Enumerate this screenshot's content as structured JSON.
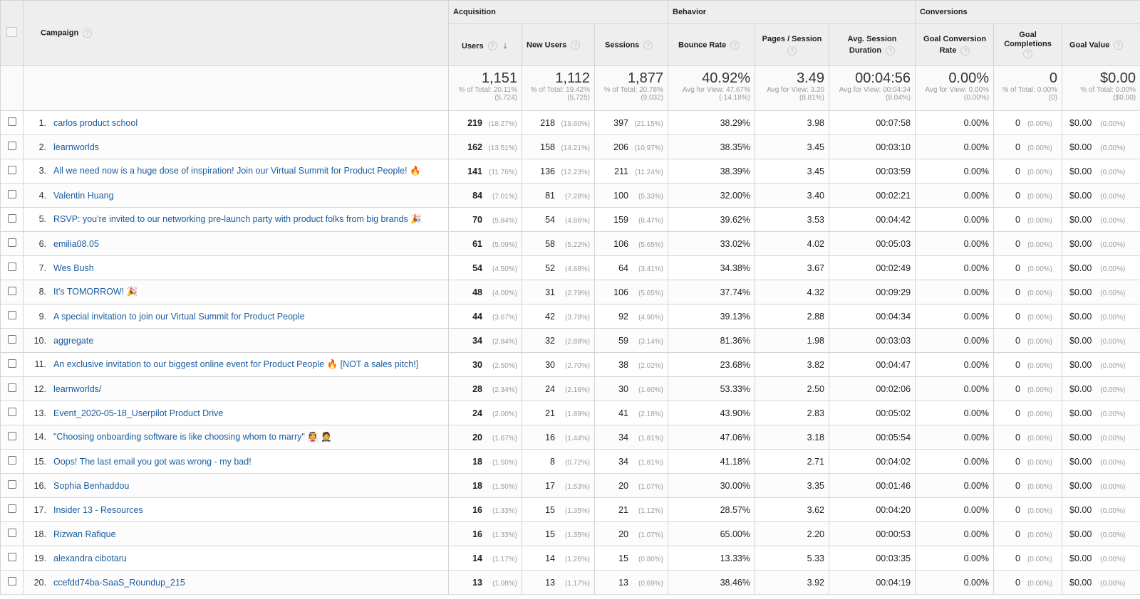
{
  "groups": {
    "acquisition": "Acquisition",
    "behavior": "Behavior",
    "conversions": "Conversions"
  },
  "columns": {
    "campaign": "Campaign",
    "users": "Users",
    "new_users": "New Users",
    "sessions": "Sessions",
    "bounce_rate": "Bounce Rate",
    "pages_session": "Pages / Session",
    "avg_duration": "Avg. Session Duration",
    "goal_conv_rate": "Goal Conversion Rate",
    "goal_completions": "Goal Completions",
    "goal_value": "Goal Value"
  },
  "help_icon": "?",
  "totals": {
    "users": {
      "value": "1,151",
      "sub": "% of Total: 20.11% (5,724)"
    },
    "new_users": {
      "value": "1,112",
      "sub": "% of Total: 19.42% (5,725)"
    },
    "sessions": {
      "value": "1,877",
      "sub": "% of Total: 20.78% (9,032)"
    },
    "bounce_rate": {
      "value": "40.92%",
      "sub": "Avg for View: 47.67% (-14.18%)"
    },
    "pages_session": {
      "value": "3.49",
      "sub": "Avg for View: 3.20 (8.81%)"
    },
    "avg_duration": {
      "value": "00:04:56",
      "sub": "Avg for View: 00:04:34 (8.04%)"
    },
    "goal_conv_rate": {
      "value": "0.00%",
      "sub": "Avg for View: 0.00% (0.00%)"
    },
    "goal_completions": {
      "value": "0",
      "sub": "% of Total: 0.00% (0)"
    },
    "goal_value": {
      "value": "$0.00",
      "sub": "% of Total: 0.00% ($0.00)"
    }
  },
  "rows": [
    {
      "n": "1.",
      "campaign": "carlos product school",
      "users": "219",
      "users_p": "(18.27%)",
      "new": "218",
      "new_p": "(19.60%)",
      "sessions": "397",
      "sessions_p": "(21.15%)",
      "bounce": "38.29%",
      "pages": "3.98",
      "dur": "00:07:58",
      "gcr": "0.00%",
      "gc": "0",
      "gc_p": "(0.00%)",
      "gv": "$0.00",
      "gv_p": "(0.00%)"
    },
    {
      "n": "2.",
      "campaign": "learnworlds",
      "users": "162",
      "users_p": "(13.51%)",
      "new": "158",
      "new_p": "(14.21%)",
      "sessions": "206",
      "sessions_p": "(10.97%)",
      "bounce": "38.35%",
      "pages": "3.45",
      "dur": "00:03:10",
      "gcr": "0.00%",
      "gc": "0",
      "gc_p": "(0.00%)",
      "gv": "$0.00",
      "gv_p": "(0.00%)"
    },
    {
      "n": "3.",
      "campaign": "All we need now is a huge dose of inspiration! Join our Virtual Summit for Product People! 🔥",
      "users": "141",
      "users_p": "(11.76%)",
      "new": "136",
      "new_p": "(12.23%)",
      "sessions": "211",
      "sessions_p": "(11.24%)",
      "bounce": "38.39%",
      "pages": "3.45",
      "dur": "00:03:59",
      "gcr": "0.00%",
      "gc": "0",
      "gc_p": "(0.00%)",
      "gv": "$0.00",
      "gv_p": "(0.00%)"
    },
    {
      "n": "4.",
      "campaign": "Valentin Huang",
      "users": "84",
      "users_p": "(7.01%)",
      "new": "81",
      "new_p": "(7.28%)",
      "sessions": "100",
      "sessions_p": "(5.33%)",
      "bounce": "32.00%",
      "pages": "3.40",
      "dur": "00:02:21",
      "gcr": "0.00%",
      "gc": "0",
      "gc_p": "(0.00%)",
      "gv": "$0.00",
      "gv_p": "(0.00%)"
    },
    {
      "n": "5.",
      "campaign": "RSVP: you're invited to our networking pre-launch party with product folks from big brands 🎉",
      "users": "70",
      "users_p": "(5.84%)",
      "new": "54",
      "new_p": "(4.86%)",
      "sessions": "159",
      "sessions_p": "(8.47%)",
      "bounce": "39.62%",
      "pages": "3.53",
      "dur": "00:04:42",
      "gcr": "0.00%",
      "gc": "0",
      "gc_p": "(0.00%)",
      "gv": "$0.00",
      "gv_p": "(0.00%)"
    },
    {
      "n": "6.",
      "campaign": "emilia08.05",
      "users": "61",
      "users_p": "(5.09%)",
      "new": "58",
      "new_p": "(5.22%)",
      "sessions": "106",
      "sessions_p": "(5.65%)",
      "bounce": "33.02%",
      "pages": "4.02",
      "dur": "00:05:03",
      "gcr": "0.00%",
      "gc": "0",
      "gc_p": "(0.00%)",
      "gv": "$0.00",
      "gv_p": "(0.00%)"
    },
    {
      "n": "7.",
      "campaign": "Wes Bush",
      "users": "54",
      "users_p": "(4.50%)",
      "new": "52",
      "new_p": "(4.68%)",
      "sessions": "64",
      "sessions_p": "(3.41%)",
      "bounce": "34.38%",
      "pages": "3.67",
      "dur": "00:02:49",
      "gcr": "0.00%",
      "gc": "0",
      "gc_p": "(0.00%)",
      "gv": "$0.00",
      "gv_p": "(0.00%)"
    },
    {
      "n": "8.",
      "campaign": "It's TOMORROW! 🎉",
      "users": "48",
      "users_p": "(4.00%)",
      "new": "31",
      "new_p": "(2.79%)",
      "sessions": "106",
      "sessions_p": "(5.65%)",
      "bounce": "37.74%",
      "pages": "4.32",
      "dur": "00:09:29",
      "gcr": "0.00%",
      "gc": "0",
      "gc_p": "(0.00%)",
      "gv": "$0.00",
      "gv_p": "(0.00%)"
    },
    {
      "n": "9.",
      "campaign": "A special invitation to join our Virtual Summit for Product People",
      "users": "44",
      "users_p": "(3.67%)",
      "new": "42",
      "new_p": "(3.78%)",
      "sessions": "92",
      "sessions_p": "(4.90%)",
      "bounce": "39.13%",
      "pages": "2.88",
      "dur": "00:04:34",
      "gcr": "0.00%",
      "gc": "0",
      "gc_p": "(0.00%)",
      "gv": "$0.00",
      "gv_p": "(0.00%)"
    },
    {
      "n": "10.",
      "campaign": "aggregate",
      "users": "34",
      "users_p": "(2.84%)",
      "new": "32",
      "new_p": "(2.88%)",
      "sessions": "59",
      "sessions_p": "(3.14%)",
      "bounce": "81.36%",
      "pages": "1.98",
      "dur": "00:03:03",
      "gcr": "0.00%",
      "gc": "0",
      "gc_p": "(0.00%)",
      "gv": "$0.00",
      "gv_p": "(0.00%)"
    },
    {
      "n": "11.",
      "campaign": "An exclusive invitation to our biggest online event for Product People 🔥 [NOT a sales pitch!]",
      "users": "30",
      "users_p": "(2.50%)",
      "new": "30",
      "new_p": "(2.70%)",
      "sessions": "38",
      "sessions_p": "(2.02%)",
      "bounce": "23.68%",
      "pages": "3.82",
      "dur": "00:04:47",
      "gcr": "0.00%",
      "gc": "0",
      "gc_p": "(0.00%)",
      "gv": "$0.00",
      "gv_p": "(0.00%)"
    },
    {
      "n": "12.",
      "campaign": "learnworlds/",
      "users": "28",
      "users_p": "(2.34%)",
      "new": "24",
      "new_p": "(2.16%)",
      "sessions": "30",
      "sessions_p": "(1.60%)",
      "bounce": "53.33%",
      "pages": "2.50",
      "dur": "00:02:06",
      "gcr": "0.00%",
      "gc": "0",
      "gc_p": "(0.00%)",
      "gv": "$0.00",
      "gv_p": "(0.00%)"
    },
    {
      "n": "13.",
      "campaign": "Event_2020-05-18_Userpilot Product Drive",
      "users": "24",
      "users_p": "(2.00%)",
      "new": "21",
      "new_p": "(1.89%)",
      "sessions": "41",
      "sessions_p": "(2.18%)",
      "bounce": "43.90%",
      "pages": "2.83",
      "dur": "00:05:02",
      "gcr": "0.00%",
      "gc": "0",
      "gc_p": "(0.00%)",
      "gv": "$0.00",
      "gv_p": "(0.00%)"
    },
    {
      "n": "14.",
      "campaign": "\"Choosing onboarding software is like choosing whom to marry\" 👰 🤵",
      "users": "20",
      "users_p": "(1.67%)",
      "new": "16",
      "new_p": "(1.44%)",
      "sessions": "34",
      "sessions_p": "(1.81%)",
      "bounce": "47.06%",
      "pages": "3.18",
      "dur": "00:05:54",
      "gcr": "0.00%",
      "gc": "0",
      "gc_p": "(0.00%)",
      "gv": "$0.00",
      "gv_p": "(0.00%)"
    },
    {
      "n": "15.",
      "campaign": "Oops! The last email you got was wrong - my bad!",
      "users": "18",
      "users_p": "(1.50%)",
      "new": "8",
      "new_p": "(0.72%)",
      "sessions": "34",
      "sessions_p": "(1.81%)",
      "bounce": "41.18%",
      "pages": "2.71",
      "dur": "00:04:02",
      "gcr": "0.00%",
      "gc": "0",
      "gc_p": "(0.00%)",
      "gv": "$0.00",
      "gv_p": "(0.00%)"
    },
    {
      "n": "16.",
      "campaign": "Sophia Benhaddou",
      "users": "18",
      "users_p": "(1.50%)",
      "new": "17",
      "new_p": "(1.53%)",
      "sessions": "20",
      "sessions_p": "(1.07%)",
      "bounce": "30.00%",
      "pages": "3.35",
      "dur": "00:01:46",
      "gcr": "0.00%",
      "gc": "0",
      "gc_p": "(0.00%)",
      "gv": "$0.00",
      "gv_p": "(0.00%)"
    },
    {
      "n": "17.",
      "campaign": "Insider 13 - Resources",
      "users": "16",
      "users_p": "(1.33%)",
      "new": "15",
      "new_p": "(1.35%)",
      "sessions": "21",
      "sessions_p": "(1.12%)",
      "bounce": "28.57%",
      "pages": "3.62",
      "dur": "00:04:20",
      "gcr": "0.00%",
      "gc": "0",
      "gc_p": "(0.00%)",
      "gv": "$0.00",
      "gv_p": "(0.00%)"
    },
    {
      "n": "18.",
      "campaign": "Rizwan Rafique",
      "users": "16",
      "users_p": "(1.33%)",
      "new": "15",
      "new_p": "(1.35%)",
      "sessions": "20",
      "sessions_p": "(1.07%)",
      "bounce": "65.00%",
      "pages": "2.20",
      "dur": "00:00:53",
      "gcr": "0.00%",
      "gc": "0",
      "gc_p": "(0.00%)",
      "gv": "$0.00",
      "gv_p": "(0.00%)"
    },
    {
      "n": "19.",
      "campaign": "alexandra cibotaru",
      "users": "14",
      "users_p": "(1.17%)",
      "new": "14",
      "new_p": "(1.26%)",
      "sessions": "15",
      "sessions_p": "(0.80%)",
      "bounce": "13.33%",
      "pages": "5.33",
      "dur": "00:03:35",
      "gcr": "0.00%",
      "gc": "0",
      "gc_p": "(0.00%)",
      "gv": "$0.00",
      "gv_p": "(0.00%)"
    },
    {
      "n": "20.",
      "campaign": "ccefdd74ba-SaaS_Roundup_215",
      "users": "13",
      "users_p": "(1.08%)",
      "new": "13",
      "new_p": "(1.17%)",
      "sessions": "13",
      "sessions_p": "(0.69%)",
      "bounce": "38.46%",
      "pages": "3.92",
      "dur": "00:04:19",
      "gcr": "0.00%",
      "gc": "0",
      "gc_p": "(0.00%)",
      "gv": "$0.00",
      "gv_p": "(0.00%)"
    }
  ]
}
